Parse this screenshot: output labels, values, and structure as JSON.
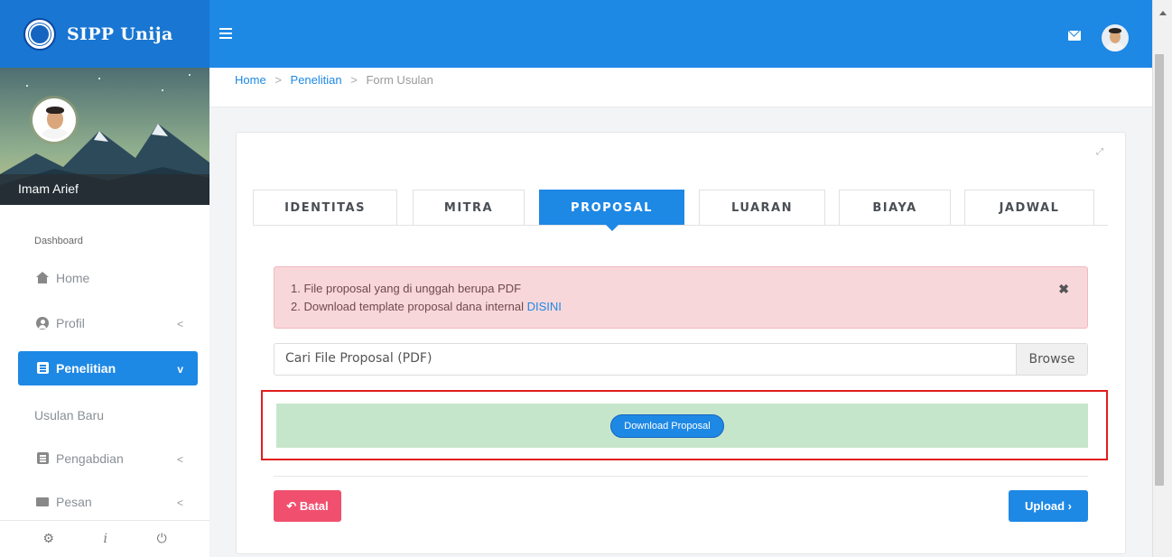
{
  "brand": {
    "name": "SIPP Unija"
  },
  "user": {
    "name": "Imam Arief"
  },
  "sidebar": {
    "section": "Dashboard",
    "items": [
      {
        "label": "Home",
        "icon": "home-icon"
      },
      {
        "label": "Profil",
        "icon": "user-circle-icon",
        "caret": "<"
      },
      {
        "label": "Penelitian",
        "icon": "document-icon",
        "caret": "v"
      },
      {
        "label": "Pengabdian",
        "icon": "document-icon",
        "caret": "<"
      },
      {
        "label": "Pesan",
        "icon": "envelope-icon",
        "caret": "<"
      }
    ],
    "sub_item": "Usulan Baru",
    "footer": {
      "settings": "⚙",
      "info": "i",
      "power": "⏻"
    }
  },
  "breadcrumb": {
    "home": "Home",
    "penelitian": "Penelitian",
    "current": "Form Usulan",
    "separator": ">"
  },
  "tabs": [
    "IDENTITAS",
    "MITRA",
    "PROPOSAL",
    "LUARAN",
    "BIAYA",
    "JADWAL"
  ],
  "active_tab": "PROPOSAL",
  "alert": {
    "line1": "1. File proposal yang di unggah berupa PDF",
    "line2_prefix": "2. Download template proposal dana internal ",
    "line2_link": "DISINI",
    "close": "✖"
  },
  "file_input": {
    "placeholder": "Cari File Proposal (PDF)",
    "browse_label": "Browse"
  },
  "download_button": "Download Proposal",
  "buttons": {
    "cancel": "↶ Batal",
    "upload": "Upload ›"
  },
  "colors": {
    "primary": "#1e88e5",
    "danger": "#f0506e",
    "alert_bg": "#f8d7da",
    "success_bg": "#c6e6cb",
    "highlight": "#e11d1d"
  }
}
